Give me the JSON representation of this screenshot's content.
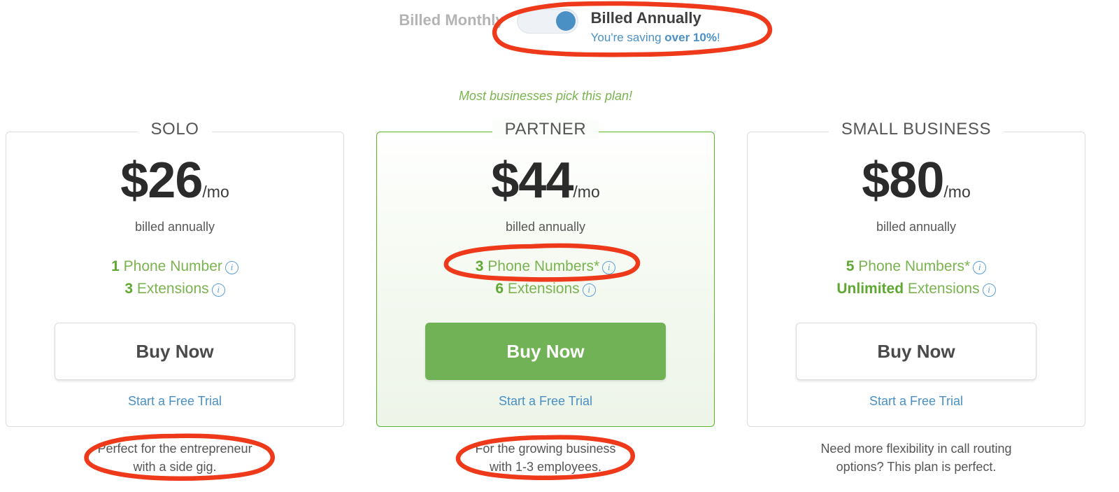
{
  "billing": {
    "monthly_label": "Billed Monthly",
    "annual_label": "Billed Annually",
    "saving_prefix": "You're saving ",
    "saving_amount": "over 10%",
    "saving_suffix": "!",
    "toggle_state": "annually",
    "toggle_icon": "toggle-switch-on-icon"
  },
  "tagline": "Most businesses pick this plan!",
  "colors": {
    "accent_green": "#72b257",
    "feature_green": "#7ab34f",
    "link_blue": "#4a90c4",
    "annotation_red": "#ee3a1a",
    "muted_grey": "#b4b4b4"
  },
  "plans": [
    {
      "name": "SOLO",
      "price_amount": "$26",
      "price_period": "/mo",
      "billed_note": "billed annually",
      "features": [
        {
          "count": "1",
          "label": " Phone Number",
          "info_icon": "info-icon"
        },
        {
          "count": "3",
          "label": " Extensions",
          "info_icon": "info-icon"
        }
      ],
      "buy_label": "Buy Now",
      "trial_label": "Start a Free Trial",
      "footer_line1": "Perfect for the entrepreneur",
      "footer_line2": "with a side gig.",
      "highlighted": false
    },
    {
      "name": "PARTNER",
      "price_amount": "$44",
      "price_period": "/mo",
      "billed_note": "billed annually",
      "features": [
        {
          "count": "3",
          "label": " Phone Numbers*",
          "info_icon": "info-icon"
        },
        {
          "count": "6",
          "label": " Extensions",
          "info_icon": "info-icon"
        }
      ],
      "buy_label": "Buy Now",
      "trial_label": "Start a Free Trial",
      "footer_line1": "For the growing business",
      "footer_line2": "with 1-3 employees.",
      "highlighted": true
    },
    {
      "name": "SMALL BUSINESS",
      "price_amount": "$80",
      "price_period": "/mo",
      "billed_note": "billed annually",
      "features": [
        {
          "count": "5",
          "label": " Phone Numbers*",
          "info_icon": "info-icon"
        },
        {
          "count": "Unlimited",
          "label": " Extensions",
          "info_icon": "info-icon"
        }
      ],
      "buy_label": "Buy Now",
      "trial_label": "Start a Free Trial",
      "footer_line1": "Need more flexibility in call routing",
      "footer_line2": "options? This plan is perfect.",
      "highlighted": false
    }
  ],
  "annotations": [
    {
      "name": "annotation-billing-toggle",
      "shape": "ellipse"
    },
    {
      "name": "annotation-partner-phone-numbers",
      "shape": "ellipse"
    },
    {
      "name": "annotation-solo-footer",
      "shape": "ellipse"
    },
    {
      "name": "annotation-partner-footer",
      "shape": "ellipse"
    }
  ]
}
